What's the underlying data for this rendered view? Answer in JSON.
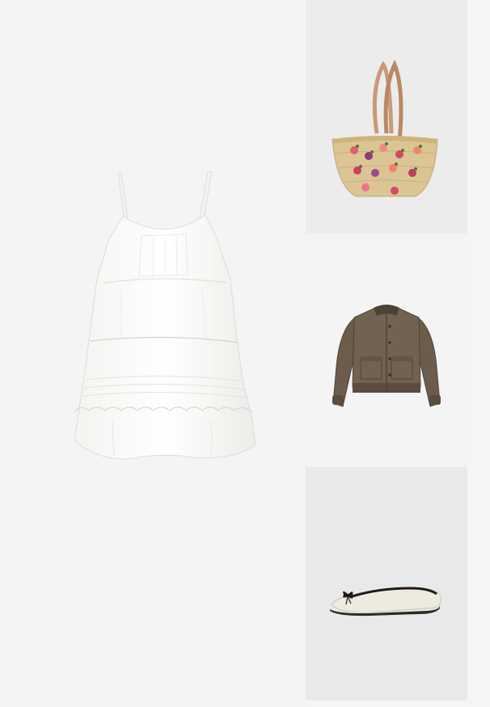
{
  "collage": {
    "items": [
      {
        "id": "dress",
        "icon": "dress-icon",
        "color": "#ffffff"
      },
      {
        "id": "bag",
        "icon": "straw-bag-icon",
        "color": "#d9c28e"
      },
      {
        "id": "jacket",
        "icon": "bomber-jacket-icon",
        "color": "#6b5c4c"
      },
      {
        "id": "shoe",
        "icon": "ballet-flat-icon",
        "color": "#eeeadf"
      }
    ],
    "background": "#f5f5f5"
  }
}
